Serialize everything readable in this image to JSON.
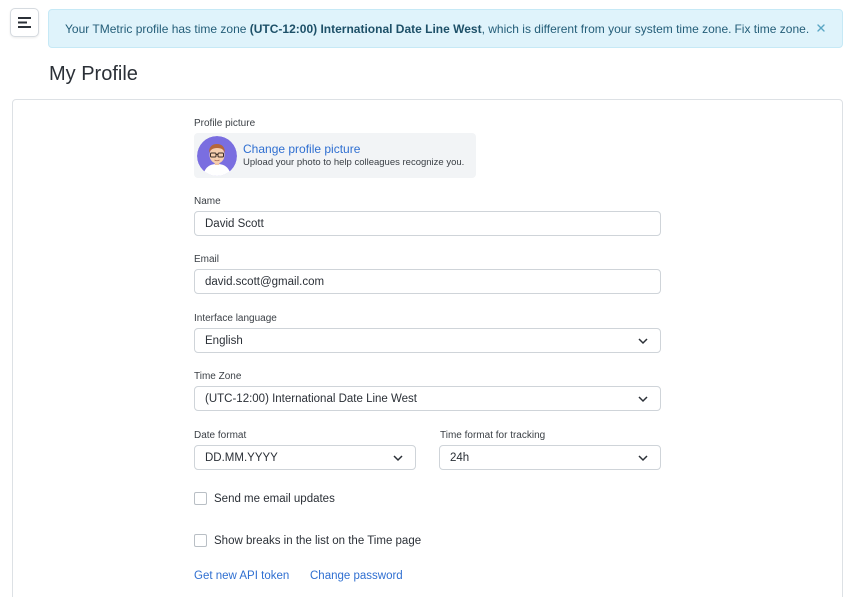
{
  "menu": {
    "icon": "menu-icon"
  },
  "alert": {
    "text_before": "Your TMetric profile has time zone",
    "timezone": "(UTC-12:00) International Date Line West",
    "text_after": ", which is different from your system time zone.",
    "fix_link": "Fix time zone.",
    "close_icon": "close-icon",
    "colors": {
      "background": "#dff3fb",
      "text": "#245e79"
    }
  },
  "page": {
    "title": "My Profile"
  },
  "profile_picture": {
    "label": "Profile picture",
    "change_link": "Change profile picture",
    "hint": "Upload your photo to help colleagues recognize you.",
    "avatar_icon": "avatar-icon"
  },
  "fields": {
    "name": {
      "label": "Name",
      "value": "David Scott"
    },
    "email": {
      "label": "Email",
      "value": "david.scott@gmail.com"
    },
    "language": {
      "label": "Interface language",
      "value": "English"
    },
    "timezone": {
      "label": "Time Zone",
      "value": "(UTC-12:00) International Date Line West"
    },
    "date_format": {
      "label": "Date format",
      "value": "DD.MM.YYYY"
    },
    "time_format": {
      "label": "Time format for tracking",
      "value": "24h"
    }
  },
  "checkboxes": {
    "email_updates": {
      "label": "Send me email updates",
      "checked": false
    },
    "show_breaks": {
      "label": "Show breaks in the list on the Time page",
      "checked": false
    }
  },
  "links": {
    "api_token": "Get new API token",
    "change_password": "Change password"
  },
  "colors": {
    "accent": "#2f6fd1",
    "border": "#cfd4d9"
  }
}
